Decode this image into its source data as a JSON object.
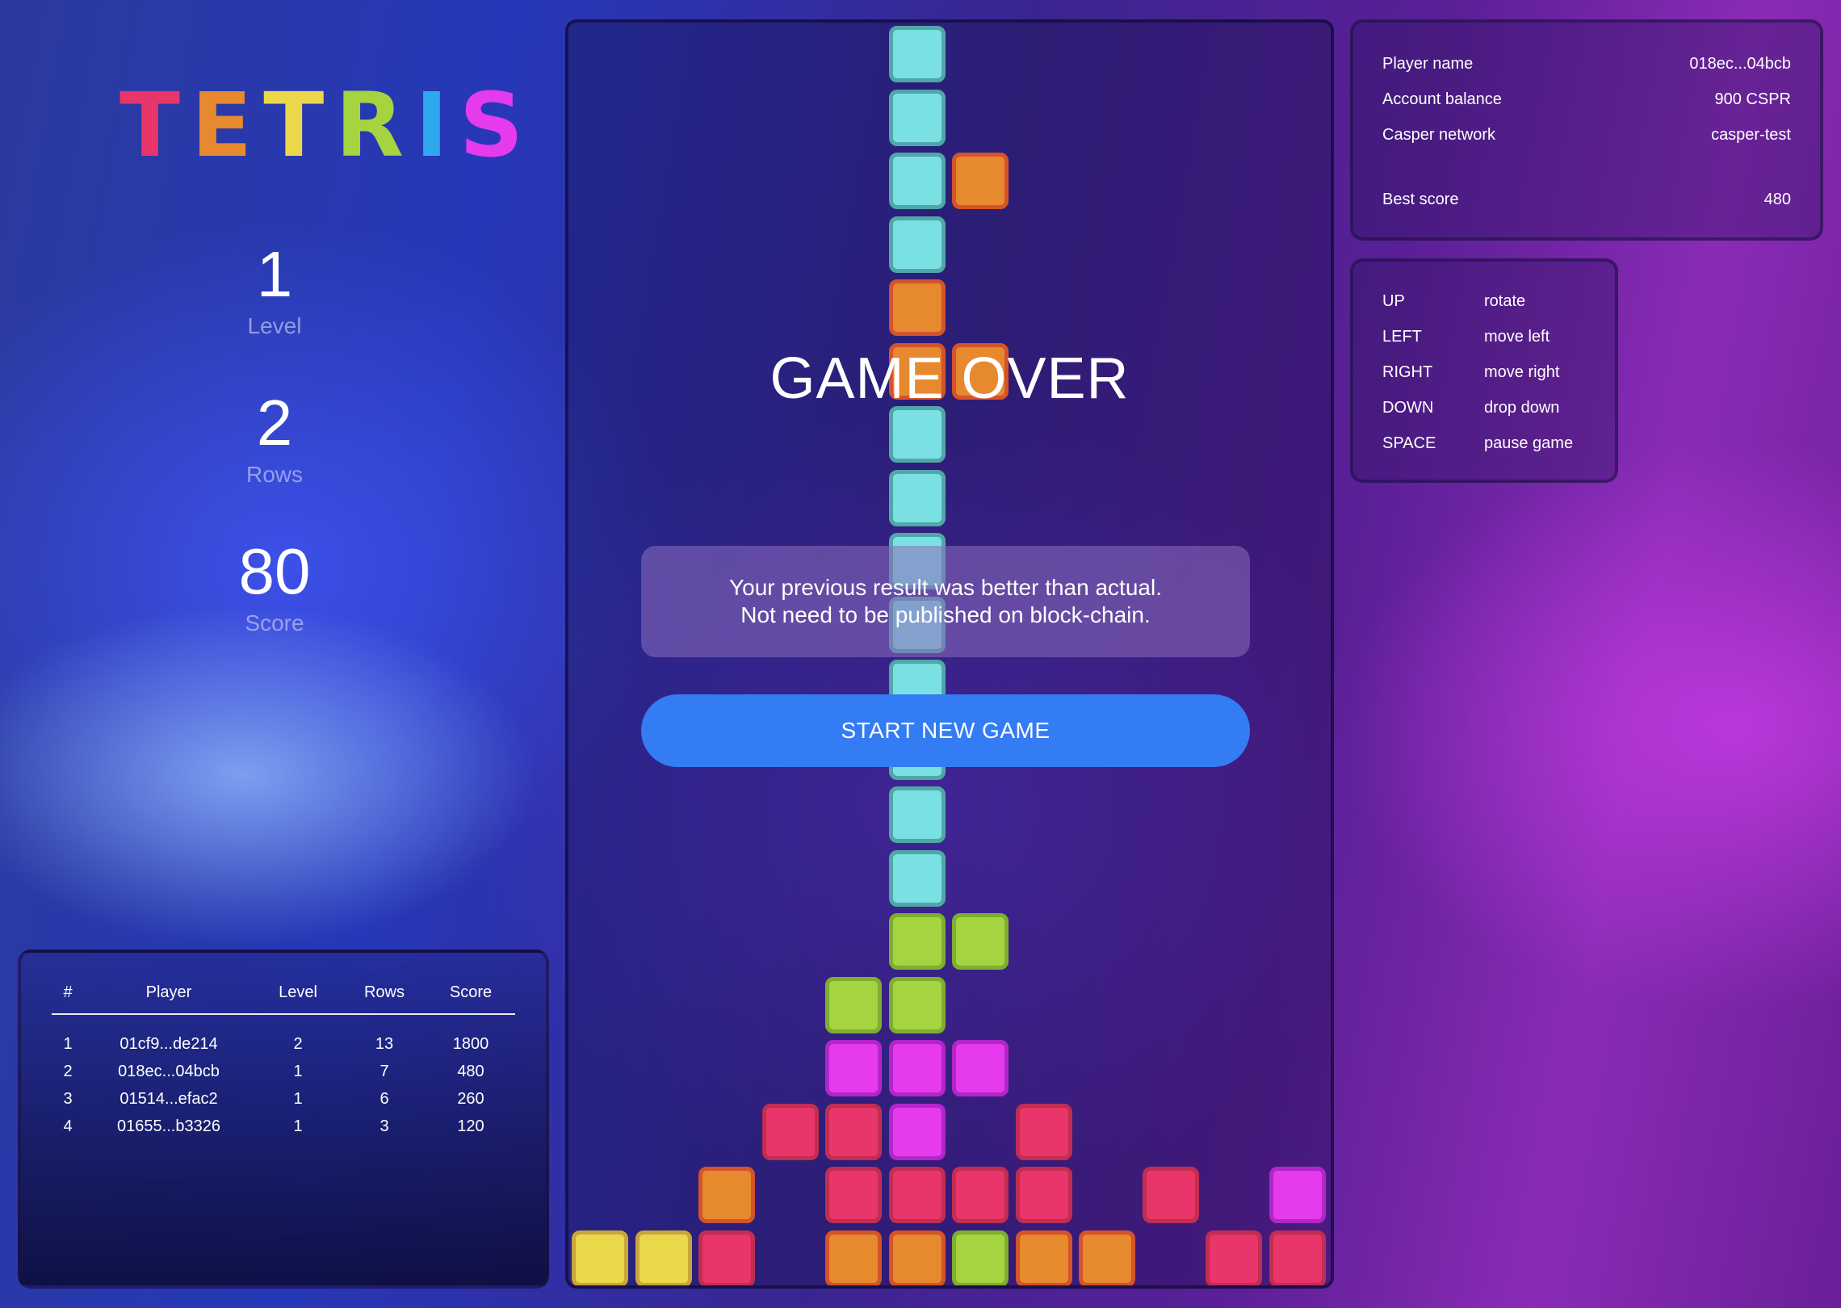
{
  "logo": {
    "letters": [
      {
        "char": "T",
        "color": "#e8356a"
      },
      {
        "char": "E",
        "color": "#e6892f"
      },
      {
        "char": "T",
        "color": "#ead84a"
      },
      {
        "char": "R",
        "color": "#a5d440"
      },
      {
        "char": "I",
        "color": "#2fa8f0"
      },
      {
        "char": "S",
        "color": "#e63bed"
      }
    ]
  },
  "stats": {
    "level": {
      "value": "1",
      "label": "Level"
    },
    "rows": {
      "value": "2",
      "label": "Rows"
    },
    "score": {
      "value": "80",
      "label": "Score"
    }
  },
  "game": {
    "title": "GAME OVER",
    "message_line1": "Your previous result was better than actual.",
    "message_line2": "Not need to be published on block-chain.",
    "start_button": "START NEW GAME",
    "colors": {
      "cyan": "#7ae0e3",
      "orange": "#e6892f",
      "green": "#a5d440",
      "magenta": "#e63bed",
      "red": "#e8356a",
      "yellow": "#ead84a"
    },
    "cells": [
      {
        "col": 5,
        "row": 0,
        "c": "cyan"
      },
      {
        "col": 5,
        "row": 1,
        "c": "cyan"
      },
      {
        "col": 5,
        "row": 2,
        "c": "cyan"
      },
      {
        "col": 6,
        "row": 2,
        "c": "orange"
      },
      {
        "col": 5,
        "row": 3,
        "c": "cyan"
      },
      {
        "col": 5,
        "row": 4,
        "c": "orange"
      },
      {
        "col": 5,
        "row": 5,
        "c": "orange"
      },
      {
        "col": 6,
        "row": 5,
        "c": "orange"
      },
      {
        "col": 5,
        "row": 6,
        "c": "cyan"
      },
      {
        "col": 5,
        "row": 7,
        "c": "cyan"
      },
      {
        "col": 5,
        "row": 8,
        "c": "cyan"
      },
      {
        "col": 5,
        "row": 9,
        "c": "cyan"
      },
      {
        "col": 5,
        "row": 10,
        "c": "cyan"
      },
      {
        "col": 5,
        "row": 11,
        "c": "cyan"
      },
      {
        "col": 5,
        "row": 12,
        "c": "cyan"
      },
      {
        "col": 5,
        "row": 13,
        "c": "cyan"
      },
      {
        "col": 5,
        "row": 14,
        "c": "green"
      },
      {
        "col": 6,
        "row": 14,
        "c": "green"
      },
      {
        "col": 4,
        "row": 15,
        "c": "green"
      },
      {
        "col": 5,
        "row": 15,
        "c": "green"
      },
      {
        "col": 4,
        "row": 16,
        "c": "magenta"
      },
      {
        "col": 5,
        "row": 16,
        "c": "magenta"
      },
      {
        "col": 6,
        "row": 16,
        "c": "magenta"
      },
      {
        "col": 3,
        "row": 17,
        "c": "red"
      },
      {
        "col": 4,
        "row": 17,
        "c": "red"
      },
      {
        "col": 5,
        "row": 17,
        "c": "magenta"
      },
      {
        "col": 7,
        "row": 17,
        "c": "red"
      },
      {
        "col": 2,
        "row": 18,
        "c": "orange"
      },
      {
        "col": 4,
        "row": 18,
        "c": "red"
      },
      {
        "col": 5,
        "row": 18,
        "c": "red"
      },
      {
        "col": 6,
        "row": 18,
        "c": "red"
      },
      {
        "col": 7,
        "row": 18,
        "c": "red"
      },
      {
        "col": 9,
        "row": 18,
        "c": "red"
      },
      {
        "col": 11,
        "row": 18,
        "c": "magenta"
      },
      {
        "col": 0,
        "row": 19,
        "c": "yellow"
      },
      {
        "col": 1,
        "row": 19,
        "c": "yellow"
      },
      {
        "col": 2,
        "row": 19,
        "c": "red"
      },
      {
        "col": 4,
        "row": 19,
        "c": "orange"
      },
      {
        "col": 5,
        "row": 19,
        "c": "orange"
      },
      {
        "col": 6,
        "row": 19,
        "c": "green"
      },
      {
        "col": 7,
        "row": 19,
        "c": "orange"
      },
      {
        "col": 8,
        "row": 19,
        "c": "orange"
      },
      {
        "col": 10,
        "row": 19,
        "c": "red"
      },
      {
        "col": 11,
        "row": 19,
        "c": "red"
      }
    ]
  },
  "leaderboard": {
    "headers": [
      "#",
      "Player",
      "Level",
      "Rows",
      "Score"
    ],
    "rows": [
      [
        "1",
        "01cf9...de214",
        "2",
        "13",
        "1800"
      ],
      [
        "2",
        "018ec...04bcb",
        "1",
        "7",
        "480"
      ],
      [
        "3",
        "01514...efac2",
        "1",
        "6",
        "260"
      ],
      [
        "4",
        "01655...b3326",
        "1",
        "3",
        "120"
      ]
    ]
  },
  "info": {
    "player_name_label": "Player name",
    "player_name": "018ec...04bcb",
    "balance_label": "Account balance",
    "balance": "900 CSPR",
    "network_label": "Casper network",
    "network": "casper-test",
    "best_label": "Best score",
    "best": "480"
  },
  "controls": [
    {
      "key": "UP",
      "action": "rotate"
    },
    {
      "key": "LEFT",
      "action": "move left"
    },
    {
      "key": "RIGHT",
      "action": "move right"
    },
    {
      "key": "DOWN",
      "action": "drop down"
    },
    {
      "key": "SPACE",
      "action": "pause game"
    }
  ]
}
